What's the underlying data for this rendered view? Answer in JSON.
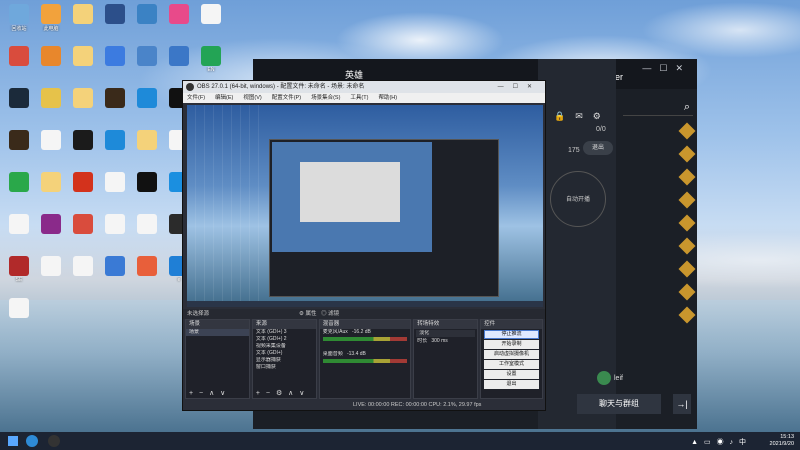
{
  "desktop": {
    "icons": [
      {
        "label": "回收站",
        "color": "#6fa8dc"
      },
      {
        "label": "此电脑",
        "color": "#f2a23c"
      },
      {
        "label": "",
        "color": "#f4d27a"
      },
      {
        "label": "",
        "color": "#2c4f8a"
      },
      {
        "label": "",
        "color": "#3b82c4"
      },
      {
        "label": "",
        "color": "#e84a8a"
      },
      {
        "label": "",
        "color": "#f5f5f5"
      },
      {
        "label": "",
        "color": "#d94c3d"
      },
      {
        "label": "",
        "color": "#e8872c"
      },
      {
        "label": "",
        "color": "#f4d27a"
      },
      {
        "label": "",
        "color": "#3c7be0"
      },
      {
        "label": "",
        "color": "#4a84c9"
      },
      {
        "label": "",
        "color": "#3b77c7"
      },
      {
        "label": "EN",
        "color": "#23a455"
      },
      {
        "label": "",
        "color": "#1b2a3a"
      },
      {
        "label": "",
        "color": "#e6c24a"
      },
      {
        "label": "",
        "color": "#f4d27a"
      },
      {
        "label": "",
        "color": "#3a2a1a"
      },
      {
        "label": "",
        "color": "#1e8ad9"
      },
      {
        "label": "",
        "color": "#111"
      },
      {
        "label": "",
        "color": "#f4d27a"
      },
      {
        "label": "",
        "color": "#3a2a1a"
      },
      {
        "label": "",
        "color": "#f5f5f5"
      },
      {
        "label": "",
        "color": "#1b1b1b"
      },
      {
        "label": "",
        "color": "#1e8ad9"
      },
      {
        "label": "",
        "color": "#f4d27a"
      },
      {
        "label": "",
        "color": "#f5f5f5"
      },
      {
        "label": "",
        "color": "#1f6b3a"
      },
      {
        "label": "",
        "color": "#2aa84a"
      },
      {
        "label": "",
        "color": "#f4d27a"
      },
      {
        "label": "",
        "color": "#d3321c"
      },
      {
        "label": "",
        "color": "#f5f5f5"
      },
      {
        "label": "",
        "color": "#111"
      },
      {
        "label": "",
        "color": "#1b8fe0"
      },
      {
        "label": "",
        "color": "#f4d27a"
      },
      {
        "label": "",
        "color": "#f5f5f5"
      },
      {
        "label": "",
        "color": "#8a2a8a"
      },
      {
        "label": "",
        "color": "#d94c3d"
      },
      {
        "label": "",
        "color": "#f5f5f5"
      },
      {
        "label": "",
        "color": "#f5f5f5"
      },
      {
        "label": "",
        "color": "#2b2b2b"
      },
      {
        "label": "",
        "color": "#e84a3a"
      },
      {
        "label": "SE",
        "color": "#b12a2a"
      },
      {
        "label": "",
        "color": "#f5f5f5"
      },
      {
        "label": "",
        "color": "#f5f5f5"
      },
      {
        "label": "",
        "color": "#3a7ad5"
      },
      {
        "label": "",
        "color": "#e85f3a"
      },
      {
        "label": "e",
        "color": "#1f7fd6"
      },
      {
        "label": "",
        "color": "#3b82c4"
      },
      {
        "label": "",
        "color": "#f5f5f5"
      }
    ]
  },
  "client": {
    "title": "英雄",
    "player": "Player",
    "stat1": "0/0",
    "stat2": "175",
    "exit_label": "退出",
    "ring_label": "自动开播",
    "bottom_button": "聊天与群组",
    "friend_name": "leif",
    "friend_rows": [
      "",
      "",
      "",
      "",
      "",
      "",
      "",
      "",
      ""
    ]
  },
  "obs": {
    "title": "OBS 27.0.1 (64-bit, windows) - 配置文件: 未命名 - 场景: 未命名",
    "menus": [
      "文件(F)",
      "编辑(E)",
      "视图(V)",
      "配置文件(P)",
      "场景集合(S)",
      "工具(T)",
      "帮助(H)"
    ],
    "source_bar": "未选择源",
    "filter_label": "属性",
    "filter_label2": "滤镜",
    "docks": {
      "scenes": {
        "header": "场景",
        "items": [
          "场景"
        ]
      },
      "sources": {
        "header": "来源",
        "items": [
          "文本 (GDI+) 3",
          "文本 (GDI+) 2",
          "视频采集设备",
          "文本 (GDI+)",
          "显示器捕获",
          "窗口捕获"
        ]
      },
      "mixer": {
        "header": "混音器",
        "rows": [
          {
            "name": "麦克风/Aux",
            "db": "-16.2 dB"
          },
          {
            "name": "桌面音频",
            "db": "-13.4 dB"
          }
        ]
      },
      "transitions": {
        "header": "转场特效",
        "type": "淡化",
        "duration_label": "时长",
        "duration": "300 ms"
      },
      "controls": {
        "header": "控件",
        "buttons": [
          "停止推流",
          "开始录制",
          "启动虚拟摄像机",
          "工作室模式",
          "设置",
          "退出"
        ]
      }
    },
    "status": "LIVE: 00:00:00   REC: 00:00:00   CPU: 2.1%, 29.97 fps"
  },
  "taskbar": {
    "time": "15:13",
    "date": "2021/9/20"
  }
}
